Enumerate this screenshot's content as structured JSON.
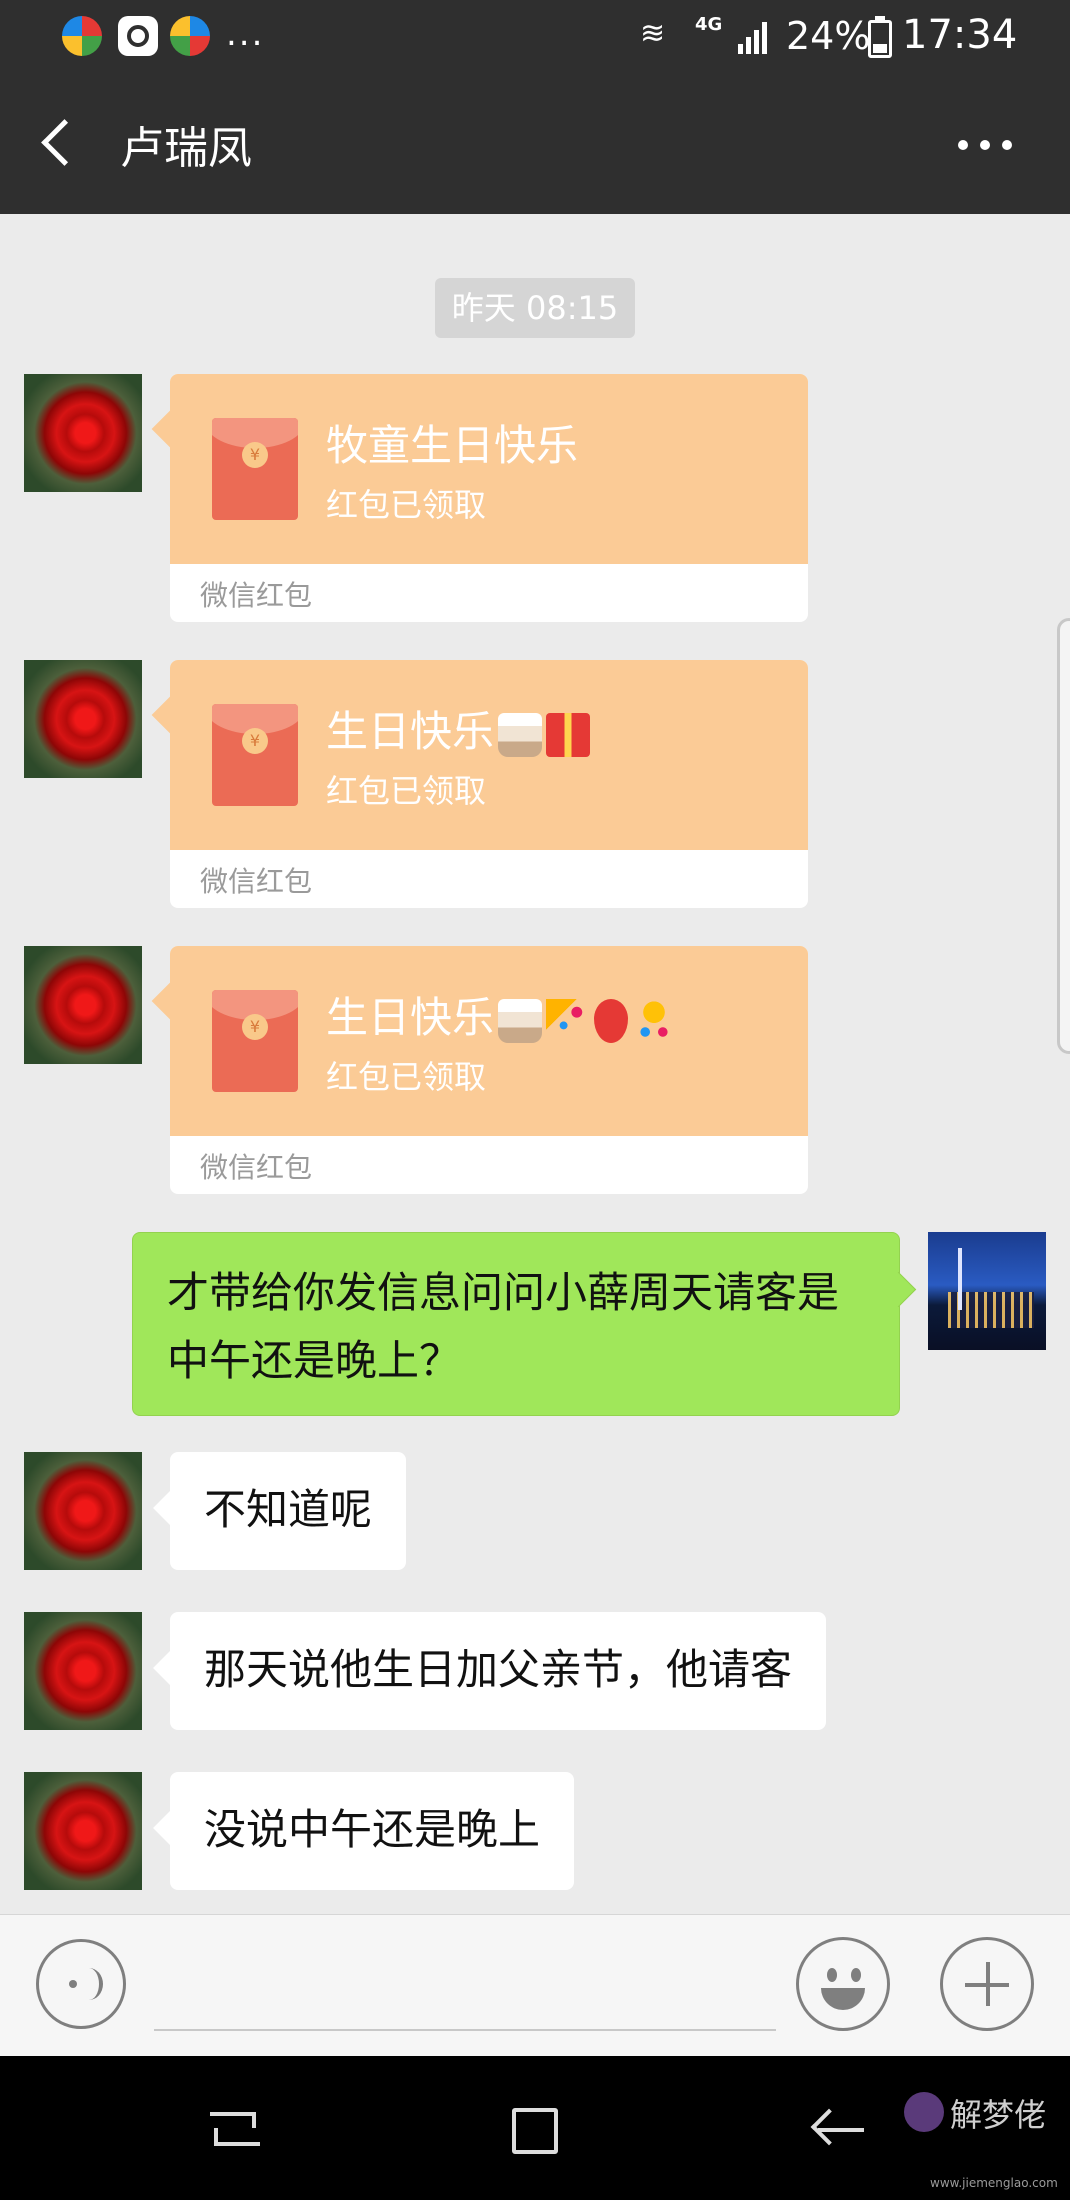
{
  "status_bar": {
    "network": "4G",
    "battery": "24%",
    "time": "17:34",
    "more_notifications": "..."
  },
  "header": {
    "title": "卢瑞凤",
    "back_icon": "chevron-left-icon",
    "more_icon": "more-horizontal-icon"
  },
  "chat": {
    "timestamp": "昨天 08:15",
    "red_packets": [
      {
        "title": "牧童生日快乐",
        "status": "红包已领取",
        "label": "微信红包",
        "emojis": []
      },
      {
        "title": "生日快乐",
        "status": "红包已领取",
        "label": "微信红包",
        "emojis": [
          "cake",
          "gift"
        ]
      },
      {
        "title": "生日快乐",
        "status": "红包已领取",
        "label": "微信红包",
        "emojis": [
          "cake",
          "party-popper",
          "balloon",
          "confetti-ball"
        ]
      }
    ],
    "sent_message": "才带给你发信息问问小薛周天请客是中午还是晚上？",
    "received_messages": [
      "不知道呢",
      "那天说他生日加父亲节，他请客",
      "没说中午还是晚上"
    ]
  },
  "input_bar": {
    "voice_icon": "voice-icon",
    "emoji_icon": "emoji-icon",
    "plus_icon": "plus-icon"
  },
  "watermark": {
    "text": "解梦佬",
    "url": "www.jiemenglao.com"
  },
  "colors": {
    "header_bg": "#2f2f2f",
    "chat_bg": "#ebebeb",
    "red_packet": "#fbcb96",
    "sent_bubble": "#a0e75a",
    "received_bubble": "#ffffff"
  }
}
